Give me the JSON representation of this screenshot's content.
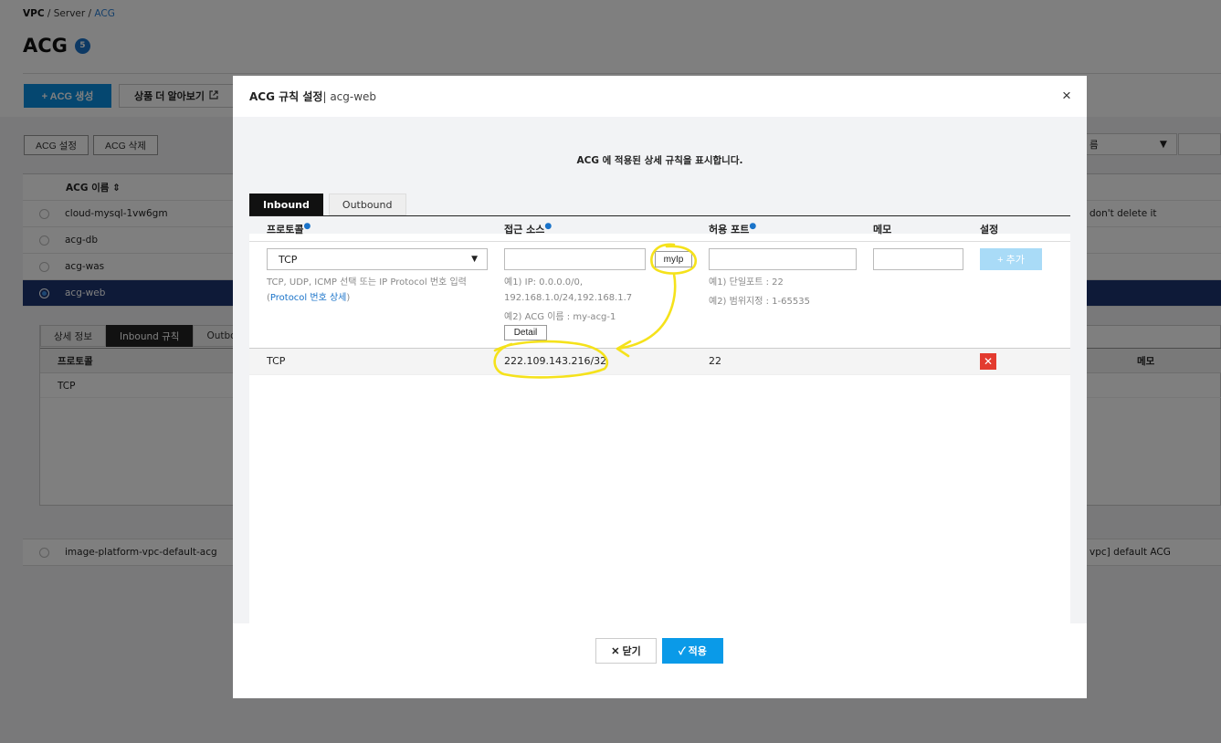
{
  "breadcrumb": {
    "root": "VPC",
    "sep": " / ",
    "mid": "Server",
    "current": "ACG"
  },
  "page": {
    "title": "ACG",
    "count": "5"
  },
  "actions": {
    "create": "+ ACG 생성",
    "more": "상품 더 알아보기"
  },
  "list_buttons": {
    "settings": "ACG 설정",
    "delete": "ACG 삭제"
  },
  "filter": {
    "selected": "름",
    "caret": "▼"
  },
  "acg_table": {
    "header": "ACG 이름 ⇕",
    "rows": [
      {
        "name": "cloud-mysql-1vw6gm",
        "memo": "don't delete it"
      },
      {
        "name": "acg-db",
        "memo": ""
      },
      {
        "name": "acg-was",
        "memo": ""
      },
      {
        "name": "acg-web",
        "memo": ""
      }
    ],
    "last_row": {
      "name": "image-platform-vpc-default-acg",
      "memo": "vpc] default ACG"
    }
  },
  "detail_tabs": [
    "상세 정보",
    "Inbound 규칙",
    "Outbo"
  ],
  "detail_table": {
    "col_protocol": "프로토콜",
    "col_memo": "메모",
    "row_protocol": "TCP"
  },
  "modal": {
    "title": "ACG 규칙 설정",
    "subtitle": " | acg-web",
    "close": "×",
    "description": "ACG 에 적용된 상세 규칙을 표시합니다.",
    "tabs": [
      "Inbound",
      "Outbound"
    ],
    "columns": {
      "protocol": "프로토콜",
      "source": "접근 소스",
      "port": "허용 포트",
      "memo": "메모",
      "action": "설정"
    },
    "required_mark": "●",
    "form": {
      "protocol_value": "TCP",
      "caret": "▼",
      "source_value": "",
      "port_value": "",
      "memo_value": "",
      "myip_label": "myIp",
      "add_label": "+ 추가",
      "protocol_hint": "TCP, UDP, ICMP 선택 또는 IP Protocol 번호 입력",
      "protocol_link": "Protocol 번호 상세",
      "source_hint1": "예1) IP: 0.0.0.0/0,",
      "source_hint2": "192.168.1.0/24,192.168.1.7",
      "source_hint3": "예2) ACG 이름 : my-acg-1",
      "detail_label": "Detail",
      "port_hint1": "예1) 단일포트 : 22",
      "port_hint2": "예2) 범위지정 : 1-65535"
    },
    "rules": [
      {
        "protocol": "TCP",
        "source": "222.109.143.216/32",
        "port": "22",
        "memo": ""
      }
    ],
    "delete_icon": "✕",
    "footer": {
      "close": "✕ 닫기",
      "apply": "✓ 적용"
    }
  },
  "annotation_color": "#f5e21b"
}
